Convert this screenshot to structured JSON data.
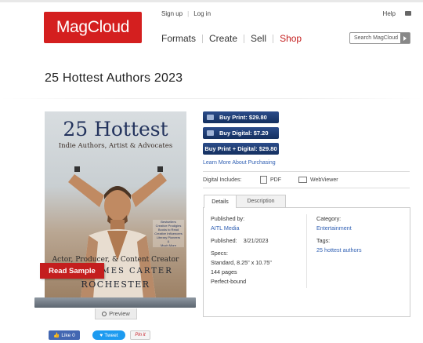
{
  "header": {
    "logo_text": "MagCloud",
    "signup": "Sign up",
    "login": "Log in",
    "help": "Help",
    "nav": [
      "Formats",
      "Create",
      "Sell",
      "Shop"
    ],
    "search_placeholder": "Search MagCloud"
  },
  "title": "25 Hottest Authors 2023",
  "cover": {
    "title_big": "25 Hottest",
    "subtitle": "Indie Authors, Artist & Advocates",
    "blurb": [
      "Bestsellers",
      "Creative Prodigies",
      "Books to Read",
      "Creative Influencers",
      "Literary Pioneers",
      "&",
      "Much More"
    ],
    "role": "Actor, Producer, & Content Creator",
    "name1": "JAMES CARTER",
    "name2": "ROCHESTER",
    "read_sample": "Read Sample",
    "preview": "Preview"
  },
  "buy": {
    "print": "Buy Print: $29.80",
    "digital": "Buy Digital: $7.20",
    "bundle": "Buy Print + Digital: $29.80",
    "learn_more": "Learn More About Purchasing"
  },
  "includes": {
    "label": "Digital Includes:",
    "pdf": "PDF",
    "webviewer": "WebViewer"
  },
  "tabs": [
    "Details",
    "Description"
  ],
  "details": {
    "published_by_label": "Published by:",
    "publisher": "AITL Media",
    "published_label": "Published:",
    "published_date": "3/21/2023",
    "specs_label": "Specs:",
    "spec_size": "Standard, 8.25\" x 10.75\"",
    "spec_pages": "144 pages",
    "spec_binding": "Perfect-bound",
    "category_label": "Category:",
    "category": "Entertainment",
    "tags_label": "Tags:",
    "tags": "25 hottest authors"
  },
  "social": {
    "like": "Like 0",
    "tweet": "Tweet",
    "pin": "Pin it"
  },
  "colors": {
    "brand_red": "#d41f1f",
    "buy_blue": "#14305f",
    "link_blue": "#2f5fb3"
  }
}
